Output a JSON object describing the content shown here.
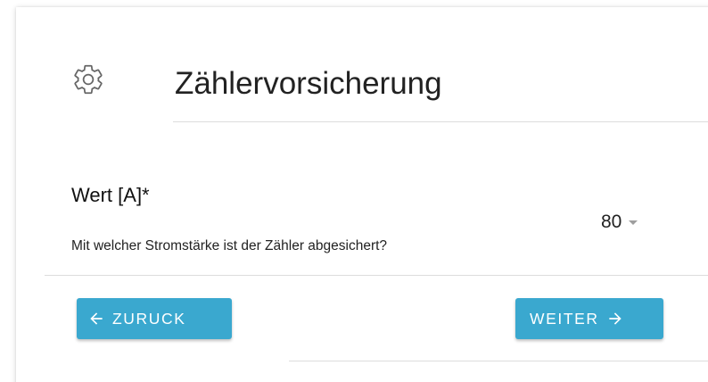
{
  "header": {
    "icon": "gear-icon",
    "title": "Zählervorsicherung"
  },
  "field": {
    "label": "Wert [A]*",
    "hint": "Mit welcher Stromstärke ist der Zähler abgesichert?",
    "selected_value": "80"
  },
  "actions": {
    "back_label": "ZURUCK",
    "back_icon": "arrow-left-icon",
    "next_label": "WEITER",
    "next_icon": "arrow-right-icon"
  },
  "colors": {
    "button_bg": "#3aa8cf",
    "button_text": "#ffffff"
  }
}
